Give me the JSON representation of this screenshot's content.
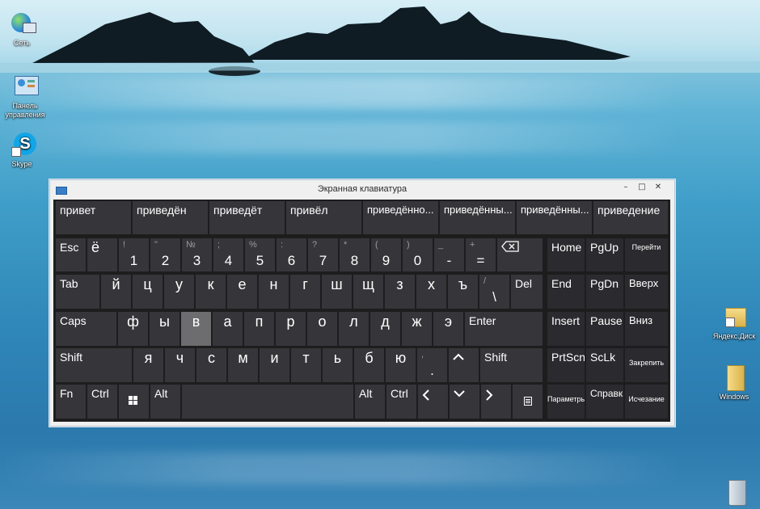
{
  "desktop": {
    "icons": [
      {
        "label": "Сеть",
        "icon": "network-icon"
      },
      {
        "label": "Панель управления",
        "icon": "control-panel-icon"
      },
      {
        "label": "Skype",
        "icon": "skype-icon"
      },
      {
        "label": "Яндекс.Диск",
        "icon": "folder-icon"
      },
      {
        "label": "Windows",
        "icon": "folder-icon"
      },
      {
        "label": "",
        "icon": "recycle-bin-icon"
      }
    ]
  },
  "window": {
    "title": "Экранная клавиатура",
    "controls": [
      "–",
      "□",
      "✕"
    ]
  },
  "predictions": [
    "привет",
    "приведён",
    "приведёт",
    "привёл",
    "приведённо...",
    "приведённы...",
    "приведённы...",
    "приведение"
  ],
  "keys": {
    "esc": "Esc",
    "yo": "ё",
    "digits": [
      {
        "shift": "!",
        "main": "1"
      },
      {
        "shift": "\"",
        "main": "2"
      },
      {
        "shift": "№",
        "main": "3"
      },
      {
        "shift": ";",
        "main": "4"
      },
      {
        "shift": "%",
        "main": "5"
      },
      {
        "shift": ":",
        "main": "6"
      },
      {
        "shift": "?",
        "main": "7"
      },
      {
        "shift": "*",
        "main": "8"
      },
      {
        "shift": "(",
        "main": "9"
      },
      {
        "shift": ")",
        "main": "0"
      },
      {
        "shift": "_",
        "main": "-"
      },
      {
        "shift": "+",
        "main": "="
      }
    ],
    "backspace": "⌫",
    "tab": "Tab",
    "row_q": [
      "й",
      "ц",
      "у",
      "к",
      "е",
      "н",
      "г",
      "ш",
      "щ",
      "з",
      "х",
      "ъ"
    ],
    "slash_shift": "/",
    "slash_main": "\\",
    "del": "Del",
    "caps": "Caps",
    "row_a": [
      "ф",
      "ы",
      "в",
      "а",
      "п",
      "р",
      "о",
      "л",
      "д",
      "ж",
      "э"
    ],
    "enter": "Enter",
    "shift": "Shift",
    "row_z": [
      "я",
      "ч",
      "с",
      "м",
      "и",
      "т",
      "ь",
      "б",
      "ю"
    ],
    "comma_shift": ",",
    "comma_main": ".",
    "up": "⌃",
    "shift_right": "Shift",
    "fn": "Fn",
    "ctrl": "Ctrl",
    "win": "⊞",
    "alt": "Alt",
    "alt_right": "Alt",
    "ctrl_right": "Ctrl",
    "left": "‹",
    "down": "⌄",
    "right": "›",
    "menu": "▤",
    "nav": {
      "home": "Home",
      "pgup": "PgUp",
      "goto": "Перейти",
      "end": "End",
      "pgdn": "PgDn",
      "vverh": "Вверх",
      "insert": "Insert",
      "pause": "Pause",
      "vniz": "Вниз",
      "prtscn": "PrtScn",
      "sclk": "ScLk",
      "zakrepit": "Закрепить",
      "params": "Параметры",
      "help": "Справка",
      "fade": "Исчезание"
    }
  },
  "highlighted_key": "в"
}
